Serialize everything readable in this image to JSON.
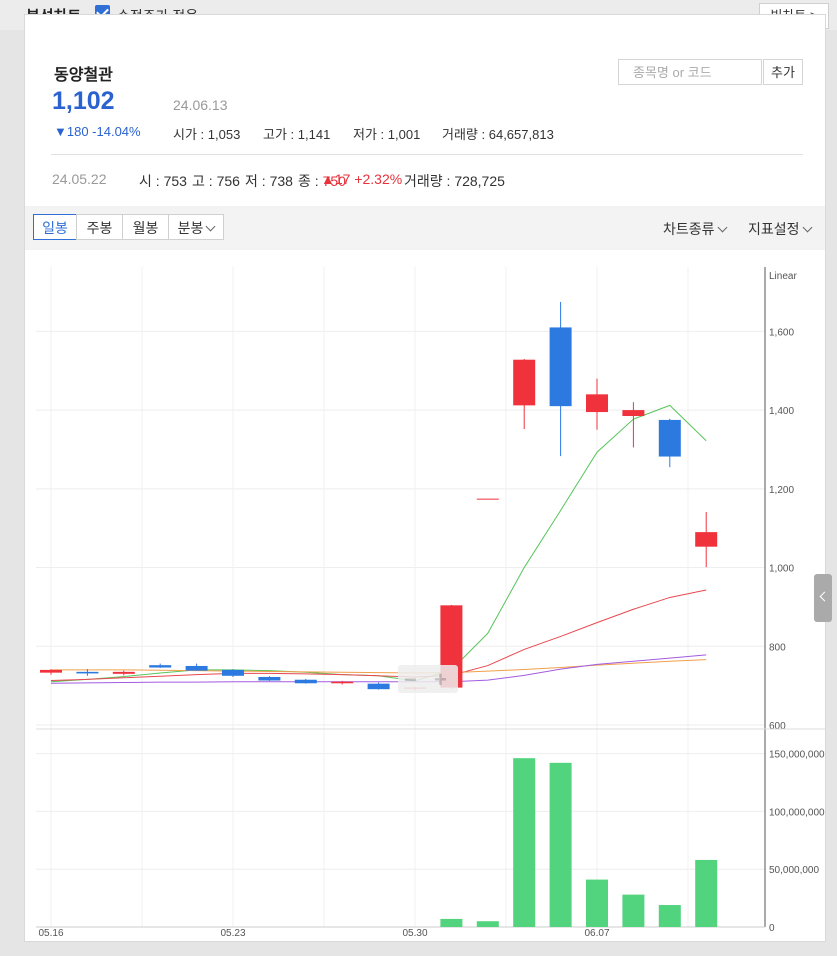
{
  "header": {
    "title": "분석차트",
    "adjusted_label": "수정주가 적용",
    "adjusted_checked": true,
    "big_chart_label": "빅차트 >"
  },
  "stock": {
    "name": "동양철관",
    "price": "1,102",
    "date": "24.06.13",
    "change": "▼180 -14.04%",
    "open_label": "시가",
    "open": "1,053",
    "high_label": "고가",
    "high": "1,141",
    "low_label": "저가",
    "low": "1,001",
    "volume_label": "거래량",
    "volume": "64,657,813"
  },
  "search": {
    "placeholder": "종목명 or 코드",
    "add_label": "추가"
  },
  "previous": {
    "date": "24.05.22",
    "open_label": "시",
    "open": "753",
    "high_label": "고",
    "high": "756",
    "low_label": "저",
    "low": "738",
    "close_label": "종",
    "close": "750",
    "change": "▲17 +2.32%",
    "volume_label": "거래량",
    "volume": "728,725"
  },
  "tabs": [
    {
      "label": "일봉",
      "active": true
    },
    {
      "label": "주봉"
    },
    {
      "label": "월봉"
    },
    {
      "label": "분봉"
    }
  ],
  "tools": {
    "chart_type": "차트종류",
    "indicator": "지표설정"
  },
  "zoom": {
    "minus": "−",
    "plus": "+"
  },
  "colors": {
    "up": "#f0323c",
    "down": "#2c7ae0",
    "volume": "#52d37e",
    "ma5": "#57c55a",
    "ma20": "#e8484f",
    "ma60": "#f0a04b",
    "ma120": "#a35be0",
    "accent": "#2f6fd6"
  },
  "chart_data": {
    "type": "candlestick",
    "scale_label": "Linear",
    "price_ylim": [
      600,
      1700
    ],
    "price_ticks": [
      {
        "value": 600,
        "label": "600"
      },
      {
        "value": 800,
        "label": "800"
      },
      {
        "value": 1000,
        "label": "1,000"
      },
      {
        "value": 1200,
        "label": "1,200"
      },
      {
        "value": 1400,
        "label": "1,400"
      },
      {
        "value": 1600,
        "label": "1,600"
      }
    ],
    "volume_ylim": [
      0,
      160000000
    ],
    "volume_ticks": [
      {
        "value": 0,
        "label": "0"
      },
      {
        "value": 50000000,
        "label": "50,000,000"
      },
      {
        "value": 100000000,
        "label": "100,000,000"
      },
      {
        "value": 150000000,
        "label": "150,000,000"
      }
    ],
    "x_labels": [
      {
        "index": 0,
        "label": "05.16"
      },
      {
        "index": 5,
        "label": "05.23"
      },
      {
        "index": 10,
        "label": "05.30"
      },
      {
        "index": 15,
        "label": "06.07"
      }
    ],
    "candles": [
      {
        "o": 733,
        "h": 742,
        "l": 728,
        "c": 740
      },
      {
        "o": 735,
        "h": 742,
        "l": 725,
        "c": 731
      },
      {
        "o": 730,
        "h": 738,
        "l": 726,
        "c": 735
      },
      {
        "o": 752,
        "h": 756,
        "l": 745,
        "c": 746
      },
      {
        "o": 750,
        "h": 756,
        "l": 738,
        "c": 738
      },
      {
        "o": 740,
        "h": 742,
        "l": 722,
        "c": 725
      },
      {
        "o": 722,
        "h": 724,
        "l": 712,
        "c": 713
      },
      {
        "o": 715,
        "h": 717,
        "l": 705,
        "c": 706
      },
      {
        "o": 706,
        "h": 712,
        "l": 703,
        "c": 710
      },
      {
        "o": 705,
        "h": 708,
        "l": 690,
        "c": 691
      },
      {
        "o": 693,
        "h": 697,
        "l": 689,
        "c": 695
      },
      {
        "o": 695,
        "h": 905,
        "l": 692,
        "c": 904
      },
      {
        "o": 1175,
        "h": 1175,
        "l": 1175,
        "c": 1175
      },
      {
        "o": 1412,
        "h": 1530,
        "l": 1352,
        "c": 1528
      },
      {
        "o": 1610,
        "h": 1675,
        "l": 1283,
        "c": 1410
      },
      {
        "o": 1395,
        "h": 1480,
        "l": 1350,
        "c": 1440
      },
      {
        "o": 1385,
        "h": 1420,
        "l": 1305,
        "c": 1400
      },
      {
        "o": 1375,
        "h": 1378,
        "l": 1255,
        "c": 1282
      },
      {
        "o": 1053,
        "h": 1141,
        "l": 1001,
        "c": 1090
      }
    ],
    "volumes": [
      0,
      0,
      0,
      0,
      0,
      0,
      0,
      0,
      0,
      0,
      0,
      7000000,
      5000000,
      146000000,
      142000000,
      41000000,
      28000000,
      19000000,
      58000000
    ],
    "ma_lines": [
      {
        "key": "ma5",
        "values": [
          710,
          716,
          723,
          732,
          740,
          740,
          738,
          734,
          728,
          725,
          712,
          740,
          833,
          1000,
          1145,
          1293,
          1377,
          1412,
          1322
        ]
      },
      {
        "key": "ma20",
        "values": [
          713,
          716,
          720,
          724,
          728,
          731,
          731,
          730,
          728,
          725,
          722,
          726,
          751,
          792,
          825,
          860,
          894,
          924,
          943
        ]
      },
      {
        "key": "ma60",
        "values": [
          740,
          740,
          740,
          739,
          738,
          737,
          736,
          735,
          734,
          733,
          732,
          733,
          737,
          741,
          746,
          752,
          757,
          762,
          766
        ]
      },
      {
        "key": "ma120",
        "values": [
          706,
          707,
          708,
          709,
          709,
          710,
          710,
          710,
          710,
          710,
          710,
          710,
          714,
          726,
          742,
          754,
          762,
          770,
          778
        ]
      }
    ]
  }
}
